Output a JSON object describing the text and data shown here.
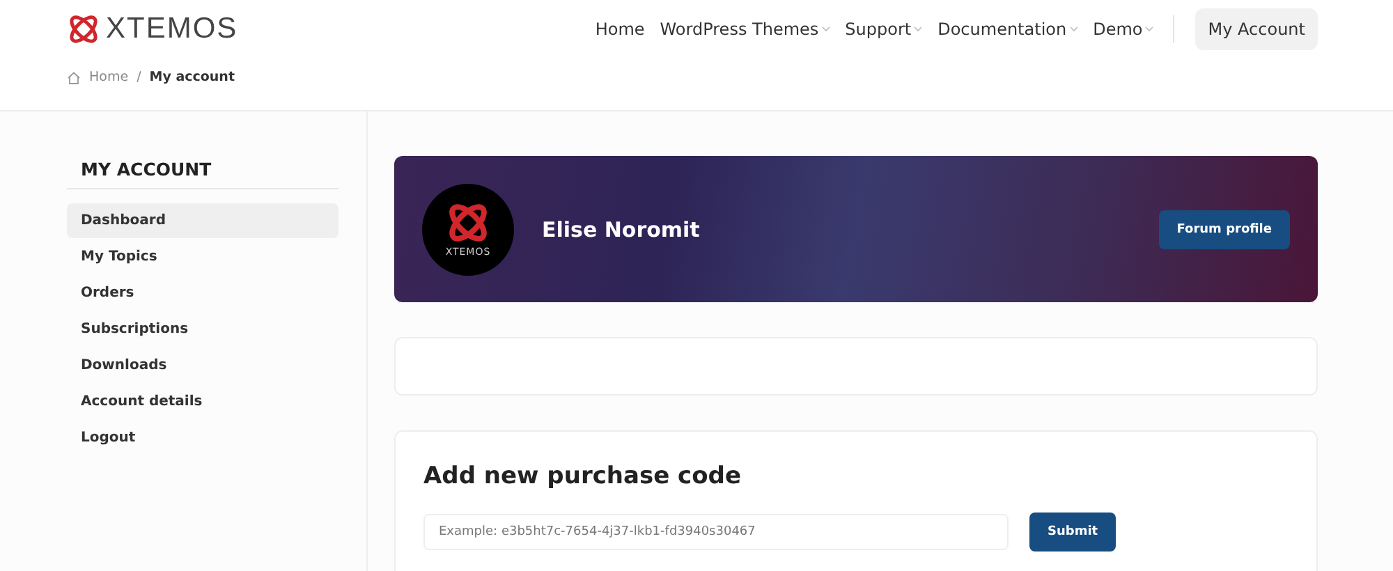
{
  "header": {
    "logo": "XTEMOS",
    "nav": [
      {
        "label": "Home",
        "has_dropdown": false
      },
      {
        "label": "WordPress Themes",
        "has_dropdown": true
      },
      {
        "label": "Support",
        "has_dropdown": true
      },
      {
        "label": "Documentation",
        "has_dropdown": true
      },
      {
        "label": "Demo",
        "has_dropdown": true
      }
    ],
    "account_button": "My Account"
  },
  "breadcrumb": {
    "home": "Home",
    "separator": "/",
    "current": "My account"
  },
  "sidebar": {
    "title": "MY ACCOUNT",
    "items": [
      {
        "label": "Dashboard",
        "selected": true
      },
      {
        "label": "My Topics",
        "selected": false
      },
      {
        "label": "Orders",
        "selected": false
      },
      {
        "label": "Subscriptions",
        "selected": false
      },
      {
        "label": "Downloads",
        "selected": false
      },
      {
        "label": "Account details",
        "selected": false
      },
      {
        "label": "Logout",
        "selected": false
      }
    ]
  },
  "profile": {
    "avatar_label": "XTEMOS",
    "name": "Elise Noromit",
    "button": "Forum profile"
  },
  "purchase": {
    "title": "Add new purchase code",
    "placeholder": "Example: e3b5ht7c-7654-4j37-lkb1-fd3940s30467",
    "button": "Submit"
  }
}
